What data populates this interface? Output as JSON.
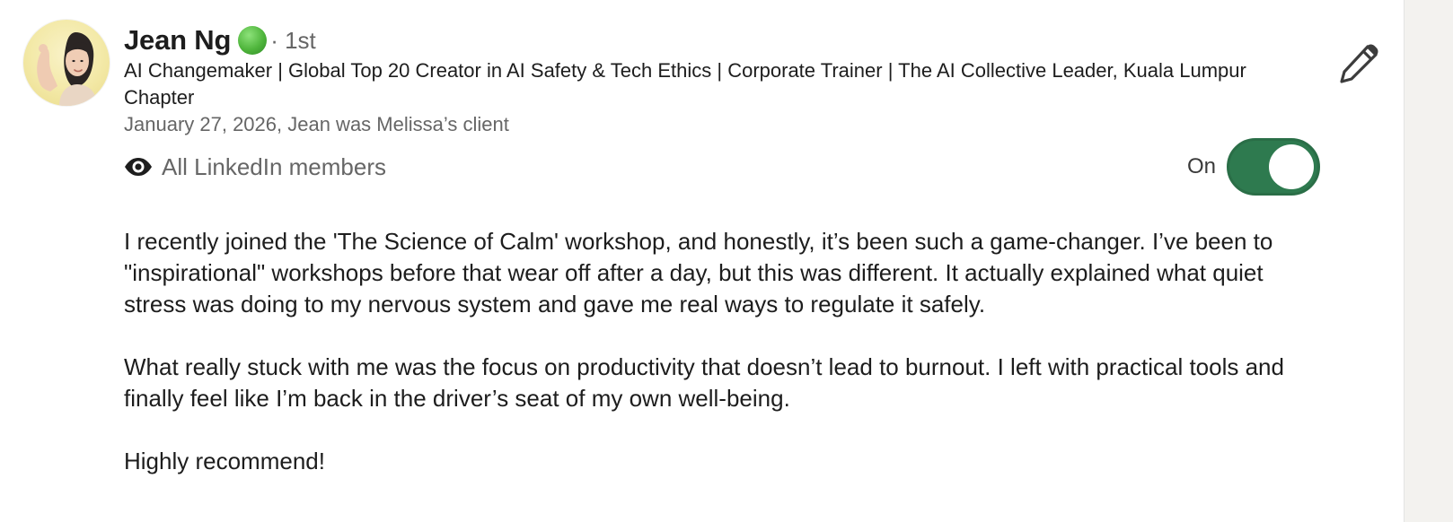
{
  "recommendation": {
    "author": {
      "name": "Jean Ng",
      "connection_degree": "· 1st",
      "headline": "AI Changemaker | Global Top 20 Creator in AI Safety & Tech Ethics | Corporate Trainer | The AI Collective Leader, Kuala Lumpur Chapter",
      "avatar_icon": "profile-photo",
      "online_status_icon": "online-status-icon"
    },
    "meta": "January 27, 2026, Jean was Melissa’s client",
    "visibility": {
      "icon": "eye-icon",
      "label": "All LinkedIn members"
    },
    "toggle": {
      "state_label": "On",
      "checked": true,
      "color": "#2e7a4f"
    },
    "edit_icon": "pencil-icon",
    "body": {
      "p1": "I recently joined the 'The Science of Calm' workshop, and honestly, it’s been such a game-changer. I’ve been to \"inspirational\" workshops before that wear off after a day, but this was different. It actually explained what quiet stress was doing to my nervous system and gave me real ways to regulate it safely.",
      "p2": "What really stuck with me was the focus on productivity that doesn’t lead to burnout. I left with practical tools and finally feel like I’m back in the driver’s seat of my own well-being.",
      "p3": "Highly recommend!"
    }
  }
}
